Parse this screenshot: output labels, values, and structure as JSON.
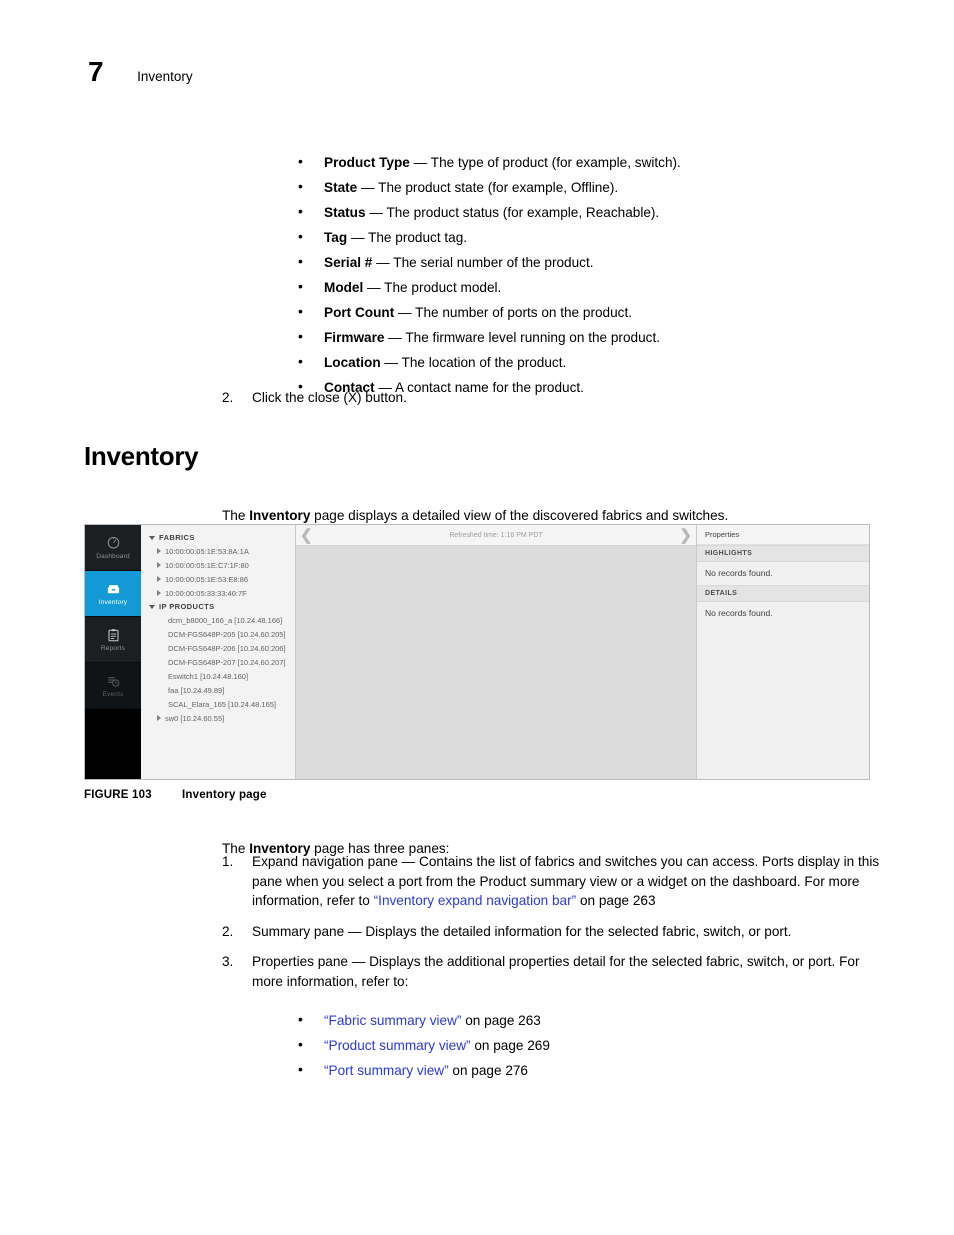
{
  "running_head": {
    "chapter_number": "7",
    "chapter_title": "Inventory"
  },
  "top_bullets": [
    {
      "term": "Product Type",
      "dash": " — ",
      "desc": "The type of product (for example, switch)."
    },
    {
      "term": "State",
      "dash": " — ",
      "desc": "The product state (for example, Offline)."
    },
    {
      "term": "Status",
      "dash": " — ",
      "desc": "The product status (for example, Reachable)."
    },
    {
      "term": "Tag",
      "dash": " — ",
      "desc": "The product tag."
    },
    {
      "term": "Serial #",
      "dash": " — ",
      "desc": "The serial number of the product."
    },
    {
      "term": "Model",
      "dash": " — ",
      "desc": "The product model."
    },
    {
      "term": "Port Count",
      "dash": " — ",
      "desc": "The number of ports on the product."
    },
    {
      "term": "Firmware",
      "dash": " — ",
      "desc": "The firmware level running on the product."
    },
    {
      "term": "Location",
      "dash": " — ",
      "desc": "The location of the product."
    },
    {
      "term": "Contact",
      "dash": " — ",
      "desc": "A contact name for the product."
    }
  ],
  "step_two": {
    "number": "2.",
    "text": "Click the close (X) button."
  },
  "heading": "Inventory",
  "intro": {
    "before": "The ",
    "bold": "Inventory",
    "after": " page displays a detailed view of the discovered fabrics and switches."
  },
  "figure": {
    "caption_label": "FIGURE 103",
    "caption_text": "Inventory page",
    "accent_color": "#139ad6",
    "rail": [
      {
        "label": "Dashboard",
        "icon": "dashboard-gauge-icon",
        "state": "normal"
      },
      {
        "label": "Inventory",
        "icon": "inventory-box-icon",
        "state": "active"
      },
      {
        "label": "Reports",
        "icon": "reports-clipboard-icon",
        "state": "normal"
      },
      {
        "label": "Events",
        "icon": "events-list-clock-icon",
        "state": "faded"
      }
    ],
    "tree": [
      {
        "type": "group",
        "label": "FABRICS",
        "expanded": true
      },
      {
        "type": "node",
        "label": "10:00:00:05:1E:53:8A:1A",
        "level": 2,
        "caret": "right"
      },
      {
        "type": "node",
        "label": "10:00:00:05:1E:C7:1F:80",
        "level": 2,
        "caret": "right"
      },
      {
        "type": "node",
        "label": "10:00:00:05:1E:53:E8:86",
        "level": 2,
        "caret": "right"
      },
      {
        "type": "node",
        "label": "10:00:00:05:33:33:40:7F",
        "level": 2,
        "caret": "right"
      },
      {
        "type": "group",
        "label": "IP PRODUCTS",
        "expanded": true
      },
      {
        "type": "node",
        "label": "dcm_b8000_166_a [10.24.48.166]",
        "level": 2,
        "caret": "none"
      },
      {
        "type": "node",
        "label": "DCM-FGS648P-205 [10.24.60.205]",
        "level": 2,
        "caret": "none"
      },
      {
        "type": "node",
        "label": "DCM-FGS648P-206 [10.24.60.206]",
        "level": 2,
        "caret": "none"
      },
      {
        "type": "node",
        "label": "DCM-FGS648P-207 [10.24.60.207]",
        "level": 2,
        "caret": "none"
      },
      {
        "type": "node",
        "label": "Eswitch1 [10.24.48.160]",
        "level": 2,
        "caret": "none"
      },
      {
        "type": "node",
        "label": "faa [10.24.49.89]",
        "level": 2,
        "caret": "none"
      },
      {
        "type": "node",
        "label": "SCAL_Elara_165 [10.24.48.165]",
        "level": 2,
        "caret": "none"
      },
      {
        "type": "node",
        "label": "sw0 [10.24.60.55]",
        "level": 2,
        "caret": "right"
      }
    ],
    "summary": {
      "prev_icon": "chevron-left-icon",
      "next_icon": "chevron-right-icon",
      "refresh_text": "Refreshed time: 1:16 PM PDT"
    },
    "properties": {
      "title": "Properties",
      "sections": [
        {
          "header": "HIGHLIGHTS",
          "value": "No records found."
        },
        {
          "header": "DETAILS",
          "value": "No records found."
        }
      ]
    }
  },
  "lower": {
    "lead_before": "The ",
    "lead_bold": "Inventory",
    "lead_after": " page has three panes:",
    "items": [
      {
        "number": "1.",
        "text_before": "Expand navigation pane — Contains the list of fabrics and switches you can access. Ports display in this pane when you select a port from the Product summary view or a widget on the dashboard. For more information, refer to ",
        "link": "“Inventory expand navigation bar”",
        "text_after": " on page 263"
      },
      {
        "number": "2.",
        "text_before": "Summary pane — Displays the detailed information for the selected fabric, switch, or port.",
        "link": "",
        "text_after": ""
      },
      {
        "number": "3.",
        "text_before": "Properties pane — Displays the additional properties detail for the selected fabric, switch, or port. For more information, refer to:",
        "link": "",
        "text_after": ""
      }
    ],
    "sub_items": [
      {
        "link": "“Fabric summary view”",
        "after": " on page 263"
      },
      {
        "link": "“Product summary view”",
        "after": " on page 269"
      },
      {
        "link": "“Port summary view”",
        "after": " on page 276"
      }
    ]
  }
}
